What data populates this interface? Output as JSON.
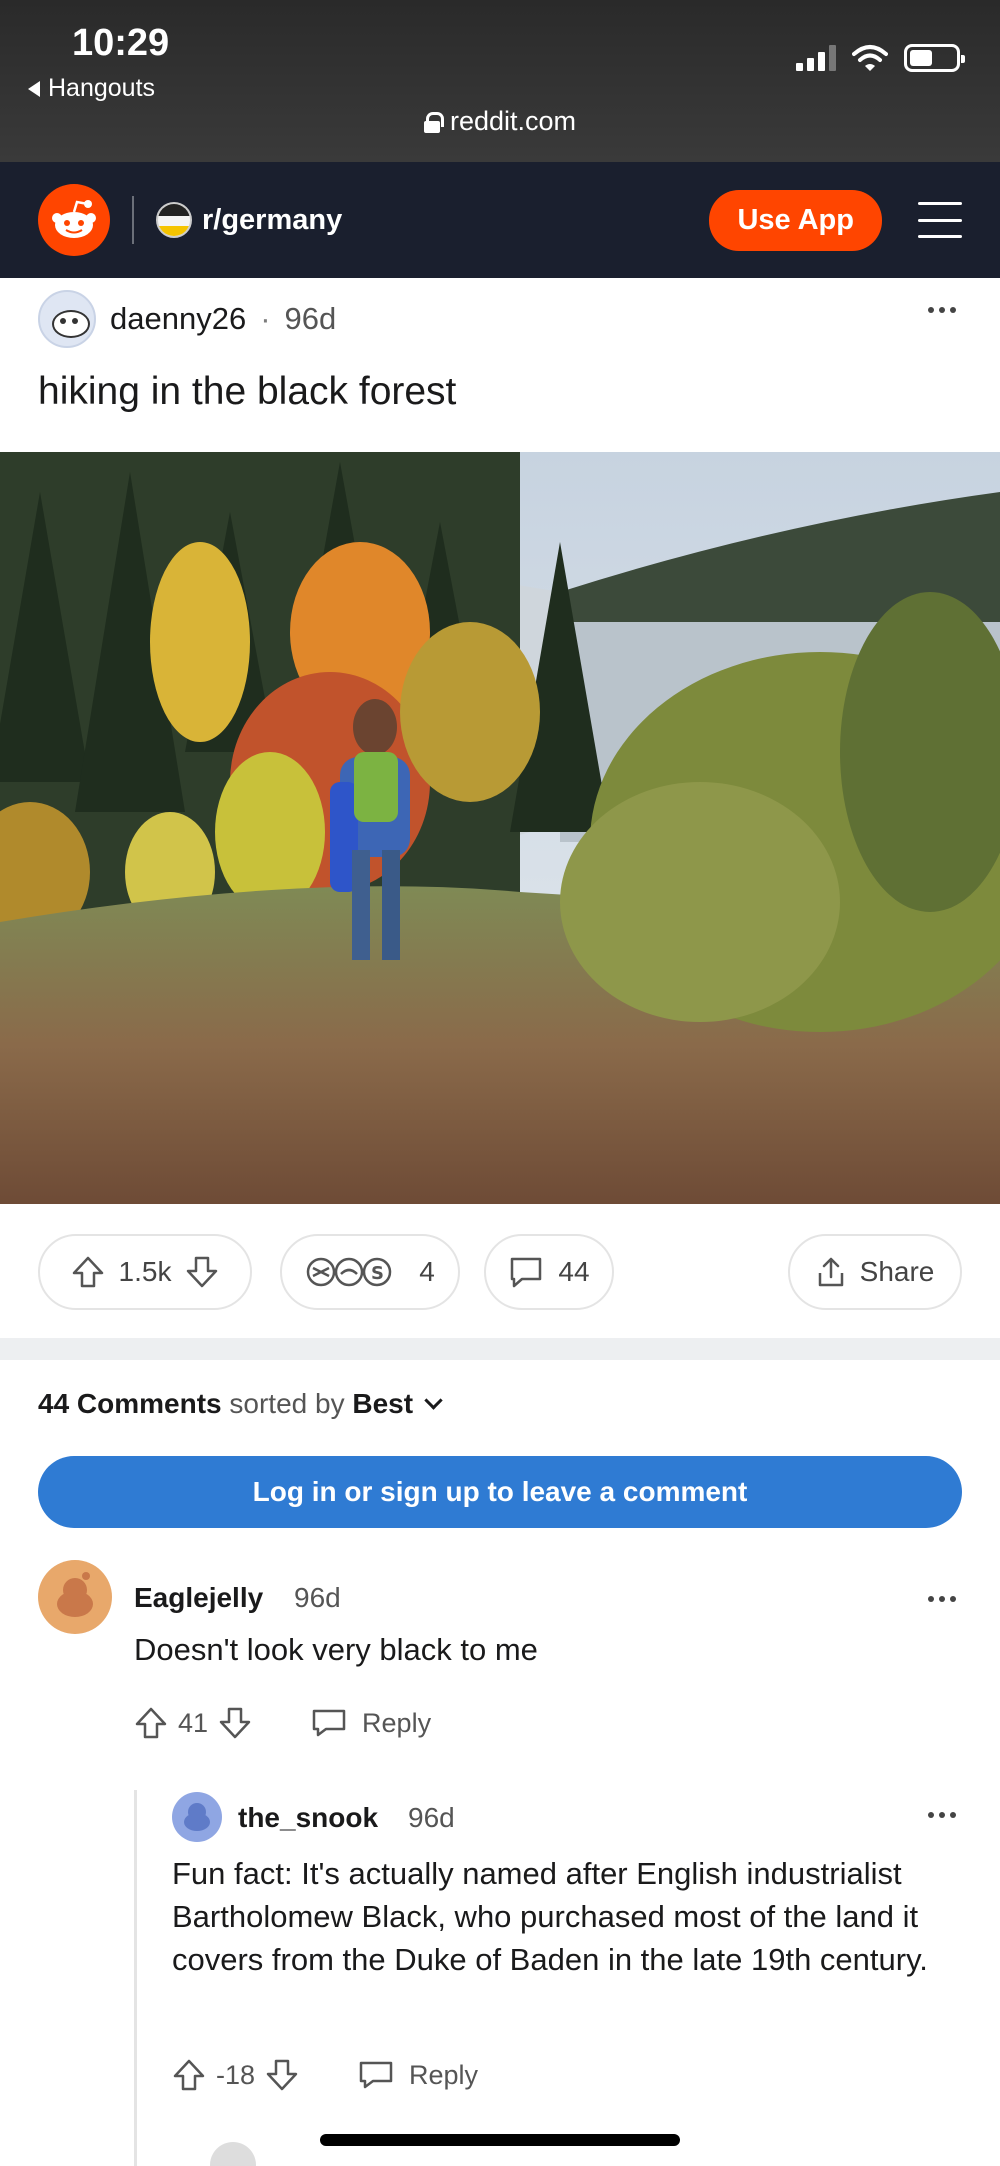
{
  "status_bar": {
    "time": "10:29",
    "back_label": "Hangouts",
    "url": "reddit.com"
  },
  "header": {
    "subreddit": "r/germany",
    "use_app_label": "Use App"
  },
  "post": {
    "author": "daenny26",
    "separator": "·",
    "age": "96d",
    "title": "hiking in the black forest",
    "upvotes": "1.5k",
    "awards_count": "4",
    "comments_count": "44",
    "share_label": "Share"
  },
  "comments_section": {
    "count_label": "44 Comments",
    "sorted_by_label": "sorted by",
    "sort_value": "Best",
    "login_prompt": "Log in or sign up to leave a comment"
  },
  "comments": [
    {
      "author": "Eaglejelly",
      "age": "96d",
      "body": "Doesn't look very black to me",
      "score": "41",
      "reply_label": "Reply"
    },
    {
      "author": "the_snook",
      "age": "96d",
      "body": "Fun fact: It's actually named after English industrialist Bartholomew Black, who purchased most of the land it covers from the Duke of Baden in the late 19th century.",
      "score": "-18",
      "reply_label": "Reply"
    }
  ],
  "colors": {
    "reddit_orange": "#ff4500",
    "header_bg": "#1a1f2e",
    "login_blue": "#2f7bd3"
  }
}
